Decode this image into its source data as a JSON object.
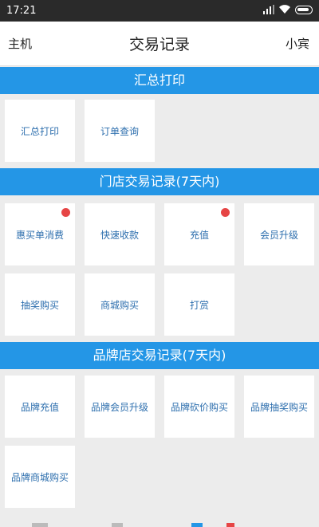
{
  "status_bar": {
    "time": "17:21",
    "battery": "battery-icon",
    "wifi": "wifi-icon",
    "signal": "signal-icon"
  },
  "header": {
    "left_label": "主机",
    "title": "交易记录",
    "right_label": "小宾"
  },
  "sections": [
    {
      "title": "汇总打印",
      "tiles": [
        {
          "label": "汇总打印",
          "dot": false
        },
        {
          "label": "订单查询",
          "dot": false
        }
      ]
    },
    {
      "title": "门店交易记录(7天内)",
      "tiles": [
        {
          "label": "惠买单消费",
          "dot": true
        },
        {
          "label": "快速收款",
          "dot": false
        },
        {
          "label": "充值",
          "dot": true
        },
        {
          "label": "会员升级",
          "dot": false
        },
        {
          "label": "抽奖购买",
          "dot": false
        },
        {
          "label": "商城购买",
          "dot": false
        },
        {
          "label": "打赏",
          "dot": false
        }
      ]
    },
    {
      "title": "品牌店交易记录(7天内)",
      "tiles": [
        {
          "label": "品牌充值",
          "dot": false
        },
        {
          "label": "品牌会员升级",
          "dot": false
        },
        {
          "label": "品牌砍价购买",
          "dot": false
        },
        {
          "label": "品牌抽奖购买",
          "dot": false
        },
        {
          "label": "品牌商城购买",
          "dot": false
        }
      ]
    }
  ],
  "colors": {
    "accent": "#2496e6",
    "badge": "#e64545",
    "tile_text": "#2e6fae"
  }
}
